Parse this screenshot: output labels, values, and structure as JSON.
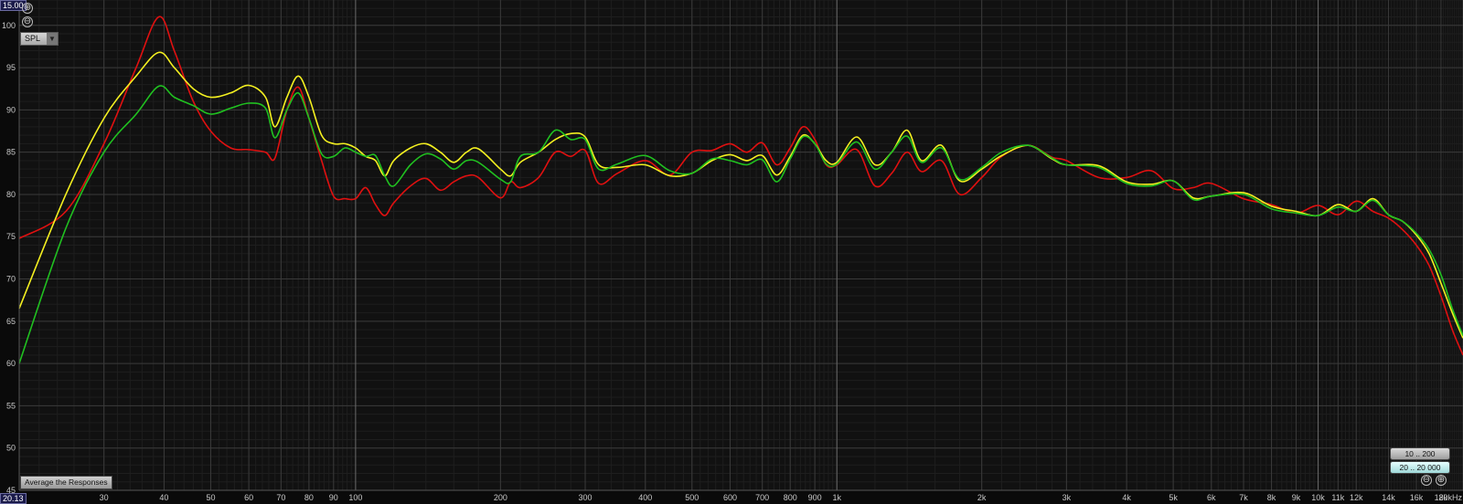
{
  "toolbar": {
    "y_top_value": "15.00",
    "x_left_value": "20.13",
    "spl_mode": "SPL",
    "average_button": "Average the Responses",
    "range_low": "10 .. 200",
    "range_full": "20 .. 20 000",
    "zoom_in_glyph": "⊕",
    "zoom_out_glyph": "⊖"
  },
  "colors": {
    "background": "#111111",
    "grid": "#3a3a3a",
    "red": "#e01010",
    "yellow": "#f4f020",
    "green": "#20c020"
  },
  "chart_data": {
    "type": "line",
    "x_scale": "log",
    "xlim": [
      20,
      20000
    ],
    "ylim": [
      45,
      103
    ],
    "y_ticks": [
      45,
      50,
      55,
      60,
      65,
      70,
      75,
      80,
      85,
      90,
      95,
      100
    ],
    "y_tick_labels": [
      "45",
      "50",
      "55",
      "60",
      "65",
      "70",
      "75",
      "80",
      "85",
      "90",
      "95",
      "100"
    ],
    "x_ticks": [
      30,
      40,
      50,
      60,
      70,
      80,
      90,
      100,
      200,
      300,
      400,
      500,
      600,
      700,
      800,
      900,
      1000,
      2000,
      3000,
      4000,
      5000,
      6000,
      7000,
      8000,
      9000,
      10000,
      11000,
      12000,
      14000,
      16000,
      18000,
      20000
    ],
    "x_tick_labels": [
      "30",
      "40",
      "50",
      "60",
      "70",
      "80",
      "90",
      "100",
      "200",
      "300",
      "400",
      "500",
      "600",
      "700",
      "800",
      "900",
      "1k",
      "2k",
      "3k",
      "4k",
      "5k",
      "6k",
      "7k",
      "8k",
      "9k",
      "10k",
      "11k",
      "12k",
      "14k",
      "16k",
      "18k",
      "20kHz"
    ],
    "grid": true,
    "series": [
      {
        "color": "#e01010",
        "x": [
          20,
          25,
          30,
          35,
          39,
          42,
          46,
          50,
          55,
          60,
          65,
          68,
          72,
          76,
          80,
          85,
          90,
          95,
          100,
          105,
          110,
          115,
          120,
          130,
          140,
          150,
          160,
          170,
          180,
          200,
          210,
          220,
          240,
          260,
          280,
          300,
          320,
          350,
          400,
          450,
          500,
          550,
          600,
          650,
          700,
          750,
          800,
          850,
          900,
          950,
          1000,
          1100,
          1200,
          1300,
          1400,
          1500,
          1650,
          1800,
          2000,
          2200,
          2500,
          2800,
          3000,
          3500,
          4000,
          4500,
          5000,
          5500,
          6000,
          7000,
          8000,
          9000,
          10000,
          11000,
          12000,
          13000,
          14000,
          15000,
          16000,
          17000,
          18000,
          19000,
          20000
        ],
        "y": [
          74.8,
          78,
          86,
          95,
          101,
          97,
          91,
          87.5,
          85.5,
          85.3,
          85,
          84.3,
          90,
          92.7,
          89,
          84,
          79.8,
          79.5,
          79.5,
          80.8,
          78.8,
          77.5,
          79,
          81,
          81.9,
          80.5,
          81.5,
          82.2,
          82,
          79.6,
          81.5,
          80.8,
          82,
          85,
          84.5,
          85.2,
          81.3,
          82.5,
          84,
          82.3,
          85,
          85.2,
          86,
          85,
          86.1,
          83.5,
          85.5,
          88,
          86.5,
          83.5,
          83.5,
          85.3,
          81,
          82.5,
          85,
          82.7,
          84,
          80,
          82,
          84.5,
          85.8,
          84.4,
          84,
          82,
          82,
          82.8,
          80.7,
          80.8,
          81.3,
          79.5,
          78.8,
          77.8,
          78.7,
          77.6,
          79.2,
          78,
          77.2,
          75.8,
          74,
          71.6,
          68,
          64,
          61
        ]
      },
      {
        "color": "#f4f020",
        "x": [
          20,
          25,
          30,
          35,
          39,
          42,
          46,
          50,
          55,
          60,
          65,
          68,
          72,
          76,
          80,
          85,
          90,
          95,
          100,
          105,
          110,
          115,
          120,
          130,
          140,
          150,
          160,
          170,
          180,
          200,
          210,
          220,
          240,
          260,
          280,
          300,
          320,
          350,
          400,
          450,
          500,
          550,
          600,
          650,
          700,
          750,
          800,
          850,
          900,
          950,
          1000,
          1100,
          1200,
          1300,
          1400,
          1500,
          1650,
          1800,
          2000,
          2200,
          2500,
          2800,
          3000,
          3500,
          4000,
          4500,
          5000,
          5500,
          6000,
          7000,
          8000,
          9000,
          10000,
          11000,
          12000,
          13000,
          14000,
          15000,
          16000,
          17000,
          18000,
          19000,
          20000
        ],
        "y": [
          66.5,
          80,
          89,
          94,
          96.8,
          95,
          92.5,
          91.5,
          92,
          92.9,
          91.5,
          88,
          91.5,
          94,
          91.5,
          87,
          86,
          86,
          85.5,
          84.5,
          84,
          82.2,
          84,
          85.5,
          86,
          85,
          83.8,
          85,
          85.4,
          83,
          82.2,
          83.8,
          85,
          86.5,
          87.2,
          86.8,
          83.5,
          83.2,
          83.5,
          82.2,
          82.5,
          84,
          84.7,
          84,
          84.6,
          82.3,
          84.5,
          87,
          86,
          84,
          83.8,
          86.8,
          83.5,
          85,
          87.6,
          84,
          85.8,
          81.6,
          83,
          84.6,
          85.8,
          84.2,
          83.5,
          83.4,
          81.5,
          81.2,
          81.6,
          79.6,
          79.8,
          80.2,
          78.6,
          78,
          77.5,
          78.8,
          78,
          79.5,
          77.6,
          76.8,
          75.2,
          73,
          69.5,
          66,
          63
        ]
      },
      {
        "color": "#20c020",
        "x": [
          20,
          25,
          30,
          35,
          39,
          42,
          46,
          50,
          55,
          60,
          65,
          68,
          72,
          76,
          80,
          85,
          90,
          95,
          100,
          105,
          110,
          115,
          120,
          130,
          140,
          150,
          160,
          170,
          180,
          200,
          210,
          220,
          240,
          260,
          280,
          300,
          320,
          350,
          400,
          450,
          500,
          550,
          600,
          650,
          700,
          750,
          800,
          850,
          900,
          950,
          1000,
          1100,
          1200,
          1300,
          1400,
          1500,
          1650,
          1800,
          2000,
          2200,
          2500,
          2800,
          3000,
          3500,
          4000,
          4500,
          5000,
          5500,
          6000,
          7000,
          8000,
          9000,
          10000,
          11000,
          12000,
          13000,
          14000,
          15000,
          16000,
          17000,
          18000,
          19000,
          20000
        ],
        "y": [
          60,
          76,
          85,
          89.5,
          92.8,
          91.5,
          90.5,
          89.5,
          90.2,
          90.8,
          90.2,
          86.7,
          90,
          92,
          89,
          84.8,
          84.5,
          85.5,
          85,
          84.5,
          84.6,
          82.2,
          81,
          83.5,
          84.8,
          84.2,
          83,
          84,
          83.8,
          81.8,
          81.5,
          84.5,
          85,
          87.6,
          86.5,
          86.5,
          83,
          83.6,
          84.6,
          82.8,
          82.5,
          84.2,
          84,
          83.5,
          84.1,
          81.5,
          84.2,
          86.8,
          86,
          83.6,
          83.6,
          86.2,
          83,
          85,
          86.9,
          83.8,
          85.5,
          81.8,
          83.2,
          85,
          85.8,
          84.3,
          83.5,
          83.2,
          81.3,
          81,
          81.6,
          79.4,
          79.8,
          80,
          78.3,
          77.8,
          77.5,
          78.5,
          78,
          79.3,
          77.6,
          76.8,
          75.4,
          73.5,
          70.5,
          66.5,
          63.3
        ]
      }
    ]
  }
}
